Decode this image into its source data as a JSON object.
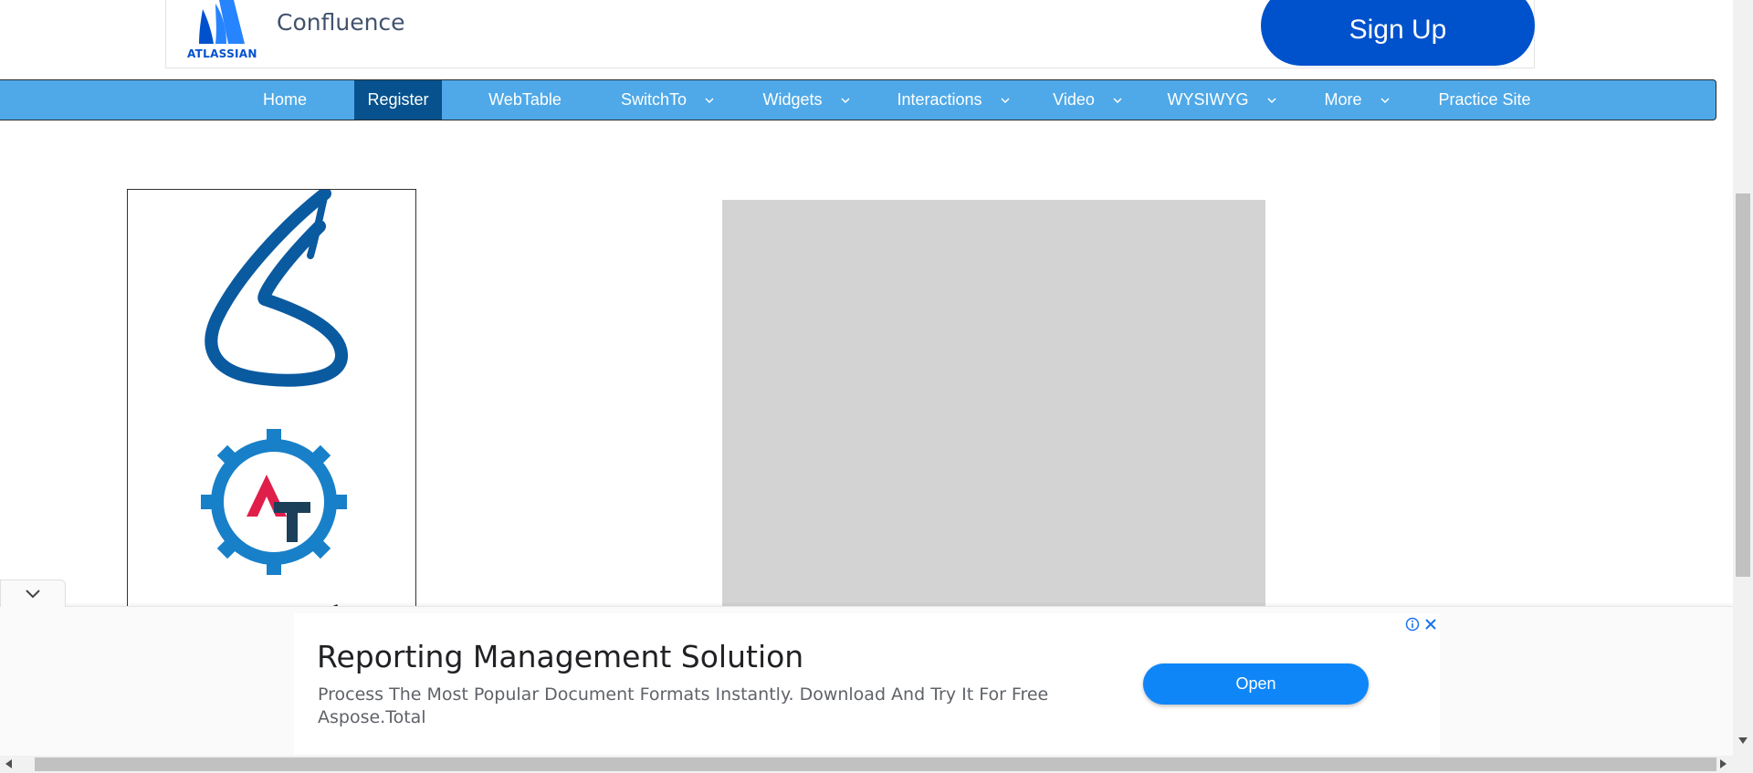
{
  "top_ad": {
    "brand_word": "ATLASSIAN",
    "product": "Confluence",
    "cta_label": "Sign Up",
    "brand_color": "#0052cc"
  },
  "nav": {
    "items": [
      {
        "label": "Home",
        "has_dropdown": false,
        "active": false
      },
      {
        "label": "Register",
        "has_dropdown": false,
        "active": true
      },
      {
        "label": "WebTable",
        "has_dropdown": false,
        "active": false
      },
      {
        "label": "SwitchTo",
        "has_dropdown": true,
        "active": false
      },
      {
        "label": "Widgets",
        "has_dropdown": true,
        "active": false
      },
      {
        "label": "Interactions",
        "has_dropdown": true,
        "active": false
      },
      {
        "label": "Video",
        "has_dropdown": true,
        "active": false
      },
      {
        "label": "WYSIWYG",
        "has_dropdown": true,
        "active": false
      },
      {
        "label": "More",
        "has_dropdown": true,
        "active": false
      },
      {
        "label": "Practice Site",
        "has_dropdown": false,
        "active": false
      }
    ],
    "background": "#4fa9e8",
    "active_background": "#07528e"
  },
  "logo_card": {
    "logos": [
      "s-letter-logo",
      "automation-testing-gear-logo"
    ]
  },
  "bottom_ad": {
    "title": "Reporting Management Solution",
    "description": "Process The Most Popular Document Formats Instantly. Download And Try It For Free",
    "brand": "Aspose.Total",
    "cta_label": "Open",
    "cta_color": "#0f86f7"
  }
}
